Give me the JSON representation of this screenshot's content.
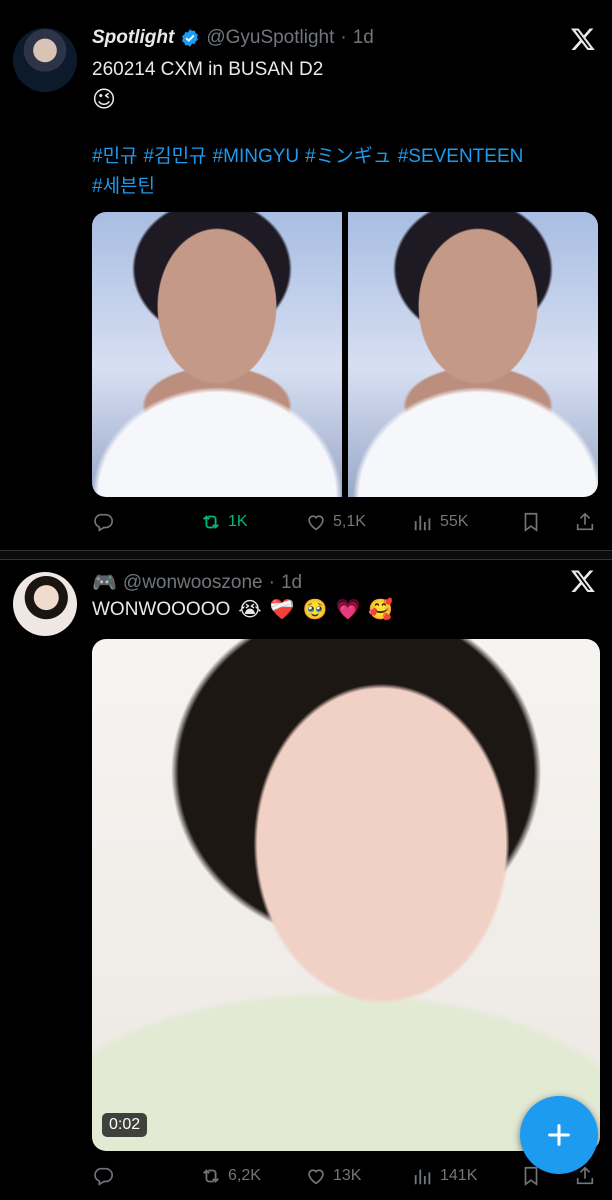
{
  "tweets": [
    {
      "display_name": "Spotlight",
      "handle": "@GyuSpotlight",
      "time": "1d",
      "text": "260214 CXM in BUSAN D2",
      "text_emoji": "😉",
      "hashtags": [
        "#민규",
        "#김민규",
        "#MINGYU",
        "#ミンギュ",
        "#SEVENTEEN",
        "#세븐틴"
      ],
      "stats": {
        "retweets": "1K",
        "likes": "5,1K",
        "views": "55K"
      }
    },
    {
      "display_name_icon": "🎮",
      "handle": "@wonwooszone",
      "time": "1d",
      "text": "WONWOOOOO",
      "emojis": [
        "😭",
        "❤️‍🩹",
        "🥹",
        "💗",
        "🥰"
      ],
      "video_duration": "0:02",
      "stats": {
        "retweets": "6,2K",
        "likes": "13K",
        "views": "141K"
      }
    }
  ],
  "colors": {
    "accent": "#1d9bf0",
    "retweet_active": "#00ba7c",
    "muted": "#71767b"
  },
  "icons": [
    "verified-badge-icon",
    "x-logo-icon",
    "reply-icon",
    "retweet-icon",
    "like-icon",
    "views-icon",
    "bookmark-icon",
    "share-icon",
    "compose-plus-icon",
    "gamepad-icon"
  ],
  "dot": "·"
}
